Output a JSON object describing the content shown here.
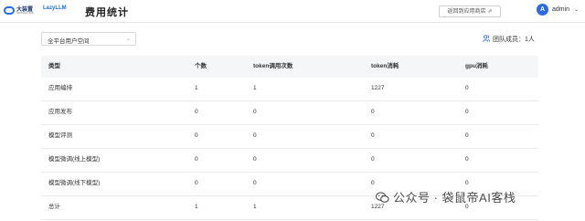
{
  "header": {
    "brand": "大装置",
    "brand_sub": "SENSECORE",
    "product": "LazyLLM",
    "page_title": "费用统计",
    "back_label": "返回到应用商店",
    "back_icon": "external-link-icon",
    "user_initial": "A",
    "user_name": "admin",
    "user_caret": "⌄"
  },
  "filter": {
    "value": "全平台用户空间",
    "caret": "⌄"
  },
  "members": {
    "icon": "team-icon",
    "label": "团队成员：1人"
  },
  "table": {
    "columns": [
      "类型",
      "个数",
      "token调用次数",
      "token消耗",
      "gpu消耗"
    ],
    "rows": [
      [
        "应用编排",
        "1",
        "1",
        "1227",
        "0"
      ],
      [
        "应用发布",
        "0",
        "0",
        "0",
        "0"
      ],
      [
        "模型评测",
        "0",
        "0",
        "0",
        "0"
      ],
      [
        "模型微调(线上模型)",
        "0",
        "0",
        "0",
        "0"
      ],
      [
        "模型微调(线下模型)",
        "0",
        "0",
        "0",
        "0"
      ],
      [
        "总计",
        "1",
        "1",
        "1227",
        "0"
      ]
    ]
  },
  "watermark": {
    "text": "公众号 · 袋鼠帝AI客栈",
    "icon": "wechat-icon"
  },
  "colors": {
    "accent": "#2c6ae8",
    "header_bg": "#f5f6f8"
  }
}
